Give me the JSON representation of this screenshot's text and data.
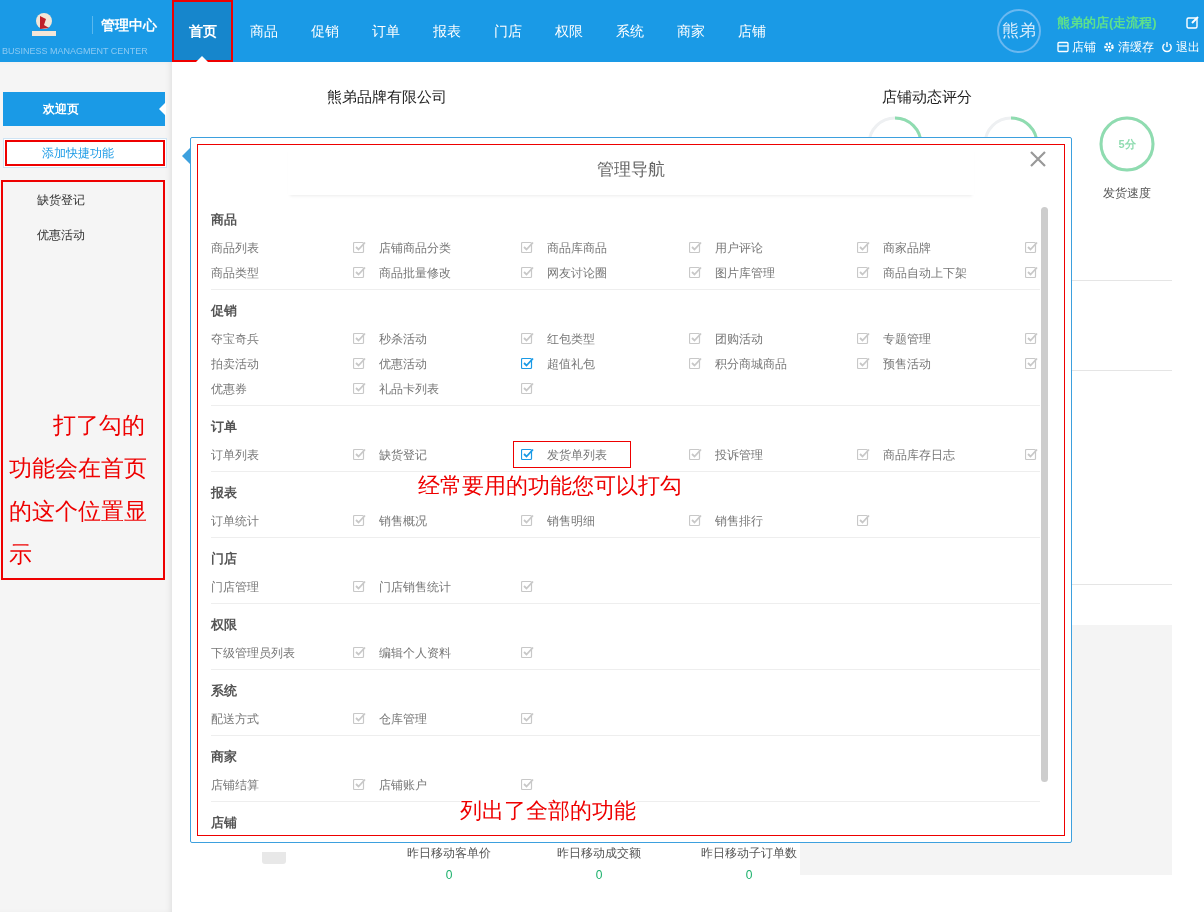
{
  "header": {
    "title": "管理中心",
    "subtitle": "BUSINESS MANAGMENT CENTER",
    "nav": [
      {
        "label": "首页",
        "selected": true
      },
      {
        "label": "商品",
        "selected": false
      },
      {
        "label": "促销",
        "selected": false
      },
      {
        "label": "订单",
        "selected": false
      },
      {
        "label": "报表",
        "selected": false
      },
      {
        "label": "门店",
        "selected": false
      },
      {
        "label": "权限",
        "selected": false
      },
      {
        "label": "系统",
        "selected": false
      },
      {
        "label": "商家",
        "selected": false
      },
      {
        "label": "店铺",
        "selected": false
      }
    ],
    "avatar_text": "熊弟",
    "shop_name": "熊弟的店(走流程)",
    "links": [
      {
        "kind": "store",
        "label": "店铺"
      },
      {
        "kind": "cache",
        "label": "清缓存"
      },
      {
        "kind": "logout",
        "label": "退出"
      }
    ]
  },
  "sidebar": {
    "items": [
      {
        "label": "欢迎页",
        "selected": true
      }
    ],
    "add_shortcut": "添加快捷功能",
    "shortcuts": [
      "缺货登记",
      "优惠活动"
    ]
  },
  "main": {
    "company": "熊弟品牌有限公司",
    "rating_title": "店铺动态评分",
    "ratings": [
      {
        "score": "5分",
        "label": "发货速度",
        "level": 1
      }
    ],
    "stats": [
      {
        "label": "昨日移动客单价",
        "value": "0"
      },
      {
        "label": "昨日移动成交额",
        "value": "0"
      },
      {
        "label": "昨日移动子订单数",
        "value": "0"
      }
    ]
  },
  "modal": {
    "title": "管理导航",
    "sections": [
      {
        "title": "商品",
        "items": [
          {
            "label": "商品列表",
            "checked": false
          },
          {
            "label": "店铺商品分类",
            "checked": false
          },
          {
            "label": "商品库商品",
            "checked": false
          },
          {
            "label": "用户评论",
            "checked": false
          },
          {
            "label": "商家品牌",
            "checked": false
          },
          {
            "label": "商品类型",
            "checked": false
          },
          {
            "label": "商品批量修改",
            "checked": false
          },
          {
            "label": "网友讨论圈",
            "checked": false
          },
          {
            "label": "图片库管理",
            "checked": false
          },
          {
            "label": "商品自动上下架",
            "checked": false
          }
        ]
      },
      {
        "title": "促销",
        "items": [
          {
            "label": "夺宝奇兵",
            "checked": false
          },
          {
            "label": "秒杀活动",
            "checked": false
          },
          {
            "label": "红包类型",
            "checked": false
          },
          {
            "label": "团购活动",
            "checked": false
          },
          {
            "label": "专题管理",
            "checked": false
          },
          {
            "label": "拍卖活动",
            "checked": false
          },
          {
            "label": "优惠活动",
            "checked": true
          },
          {
            "label": "超值礼包",
            "checked": false
          },
          {
            "label": "积分商城商品",
            "checked": false
          },
          {
            "label": "预售活动",
            "checked": false
          },
          {
            "label": "优惠券",
            "checked": false
          },
          {
            "label": "礼品卡列表",
            "checked": false
          }
        ]
      },
      {
        "title": "订单",
        "items": [
          {
            "label": "订单列表",
            "checked": false,
            "highlighted": false
          },
          {
            "label": "缺货登记",
            "checked": true,
            "highlighted": false
          },
          {
            "label": "发货单列表",
            "checked": false,
            "highlighted": true
          },
          {
            "label": "投诉管理",
            "checked": false,
            "highlighted": false
          },
          {
            "label": "商品库存日志",
            "checked": false,
            "highlighted": false
          }
        ]
      },
      {
        "title": "报表",
        "items": [
          {
            "label": "订单统计",
            "checked": false
          },
          {
            "label": "销售概况",
            "checked": false
          },
          {
            "label": "销售明细",
            "checked": false
          },
          {
            "label": "销售排行",
            "checked": false
          }
        ]
      },
      {
        "title": "门店",
        "items": [
          {
            "label": "门店管理",
            "checked": false
          },
          {
            "label": "门店销售统计",
            "checked": false
          }
        ]
      },
      {
        "title": "权限",
        "items": [
          {
            "label": "下级管理员列表",
            "checked": false
          },
          {
            "label": "编辑个人资料",
            "checked": false
          }
        ]
      },
      {
        "title": "系统",
        "items": [
          {
            "label": "配送方式",
            "checked": false
          },
          {
            "label": "仓库管理",
            "checked": false
          }
        ]
      },
      {
        "title": "商家",
        "items": [
          {
            "label": "店铺结算",
            "checked": false
          },
          {
            "label": "店铺账户",
            "checked": false
          }
        ]
      },
      {
        "title": "店铺"
      }
    ]
  },
  "annotations": [
    {
      "text": "打了勾的功能会在首页的这个位置显示"
    },
    {
      "text": "经常要用的功能您可以打勾"
    },
    {
      "text": "列出了全部的功能"
    }
  ]
}
